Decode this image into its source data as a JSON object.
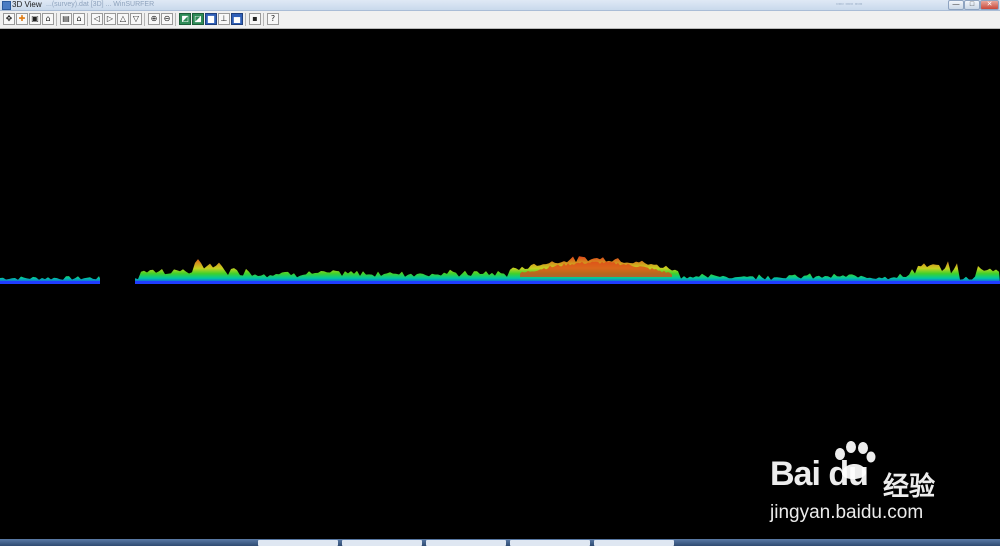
{
  "window": {
    "title": "3D View",
    "title_faded": "...(survey).dat [3D] ... WinSURFER",
    "title_right_faded": "▫▫▫ ▫▫▫ ▫▫▫",
    "controls": {
      "minimize": "—",
      "maximize": "□",
      "close": "✕"
    }
  },
  "toolbar": {
    "groups": [
      [
        {
          "name": "move-arrows-icon",
          "glyph": "✥",
          "style": ""
        },
        {
          "name": "pan-icon",
          "glyph": "✚",
          "style": "orange"
        },
        {
          "name": "copy-view-icon",
          "glyph": "▣",
          "style": ""
        },
        {
          "name": "perspective-icon",
          "glyph": "⌂",
          "style": ""
        }
      ],
      [
        {
          "name": "layers-icon",
          "glyph": "▤",
          "style": ""
        },
        {
          "name": "home-view-icon",
          "glyph": "⌂",
          "style": ""
        }
      ],
      [
        {
          "name": "rotate-left-icon",
          "glyph": "◁",
          "style": ""
        },
        {
          "name": "rotate-right-icon",
          "glyph": "▷",
          "style": ""
        },
        {
          "name": "tilt-up-icon",
          "glyph": "△",
          "style": ""
        },
        {
          "name": "tilt-down-icon",
          "glyph": "▽",
          "style": ""
        }
      ],
      [
        {
          "name": "zoom-in-icon",
          "glyph": "⊕",
          "style": ""
        },
        {
          "name": "zoom-out-icon",
          "glyph": "⊖",
          "style": ""
        }
      ],
      [
        {
          "name": "surface-grid-icon",
          "glyph": "◩",
          "style": "green"
        },
        {
          "name": "surface-shaded-icon",
          "glyph": "◪",
          "style": "green"
        },
        {
          "name": "color-map-icon",
          "glyph": "▆",
          "style": "blue"
        },
        {
          "name": "axis-icon",
          "glyph": "⊥",
          "style": ""
        },
        {
          "name": "scale-bar-icon",
          "glyph": "▅",
          "style": "blue"
        }
      ],
      [
        {
          "name": "save-icon",
          "glyph": "▪",
          "style": ""
        }
      ],
      [
        {
          "name": "help-icon",
          "glyph": "?",
          "style": ""
        }
      ]
    ]
  },
  "watermark": {
    "logo_text": "Bai du",
    "logo_cn": "经验",
    "url": "jingyan.baidu.com"
  },
  "colors": {
    "background": "#000000",
    "low": "#1f3cff",
    "mid": "#00c8a0",
    "green": "#3fd12a",
    "yellow": "#c8d020",
    "high": "#e0441a"
  }
}
